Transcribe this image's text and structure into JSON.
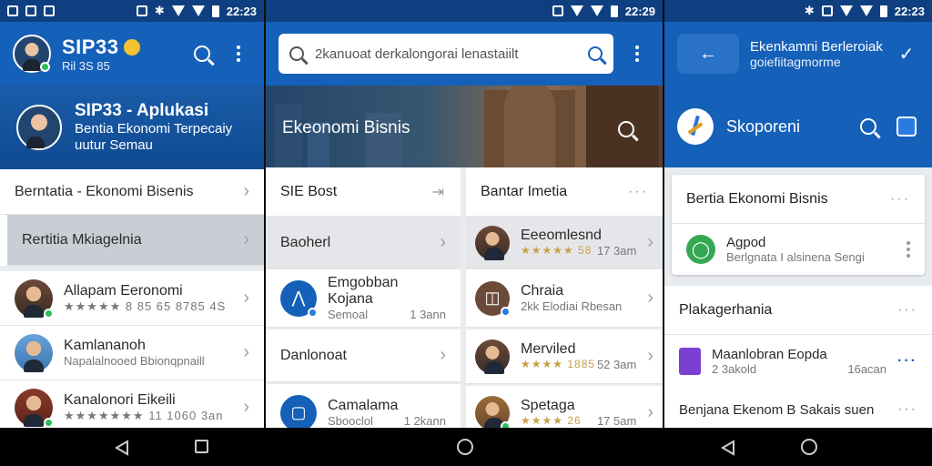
{
  "status": {
    "time_left": "22:23",
    "time_mid": "22:29",
    "time_right": "22:23"
  },
  "panel1": {
    "app_title": "SIP33",
    "app_sub": "Ril 3S 85",
    "hero_title": "SIP33 - Aplukasi",
    "hero_line2": "Bentia Ekonomi Terpecaiy",
    "hero_line3": "uutur Semau",
    "menu": [
      {
        "label": "Berntatia - Ekonomi Bisenis"
      },
      {
        "label": "Rertitia Mkiagelnia"
      }
    ],
    "list": [
      {
        "title": "Allapam Eeronomi",
        "meta": "★★★★★ 8 85 65 8785 4S"
      },
      {
        "title": "Kamlananoh",
        "meta": "Napalalnooed Bbionqpnaill"
      },
      {
        "title": "Kanalonori Eikeili",
        "meta": "★★★★★★★ 11 1060 3an"
      }
    ]
  },
  "panel2": {
    "search_text": "2kanuoat derkalongorai lenastaiilt",
    "hero_label": "Ekeonomi Bisnis",
    "left_col": {
      "header": "SIE Bost",
      "rows": [
        {
          "title": "Baoherl"
        },
        {
          "title": "Emgobban Kojana",
          "meta_a": "Semoal",
          "meta_b": "1 3ann"
        },
        {
          "title": "Danlonoat"
        },
        {
          "title": "Camalama",
          "meta_a": "Sbooclol",
          "meta_b": "1 2kann"
        }
      ]
    },
    "right_col": {
      "header": "Bantar Imetia",
      "rows": [
        {
          "title": "Eeeomlesnd",
          "meta_a": "★★★★★ 58",
          "meta_b": "17 3am"
        },
        {
          "title": "Chraia",
          "meta_a": "2kk Elodiai Rbesan",
          "meta_b": ""
        },
        {
          "title": "Merviled",
          "meta_a": "★★★★ 1885",
          "meta_b": "52 3am"
        },
        {
          "title": "Spetaga",
          "meta_a": "★★★★ 26",
          "meta_b": "17 5am"
        }
      ]
    }
  },
  "panel3": {
    "app_title": "Ekenkamni Berleroiak",
    "app_sub": "goiefiitagmorme",
    "hero_label": "Skoporeni",
    "card1_header": "Bertia Ekonomi Bisnis",
    "card1_item_title": "Agpod",
    "card1_item_meta": "Berlgnata I alsinena Sengi",
    "card2_header": "Plakagerhania",
    "card2_item_title": "Maanlobran Eopda",
    "card2_item_meta_a": "2 3akold",
    "card2_item_meta_b": "16acan",
    "card2_footer": "Benjana Ekenom B Sakais suen"
  },
  "colors": {
    "primary": "#1560b8",
    "primary_dark": "#0f3f80",
    "online": "#2bbd5a"
  }
}
